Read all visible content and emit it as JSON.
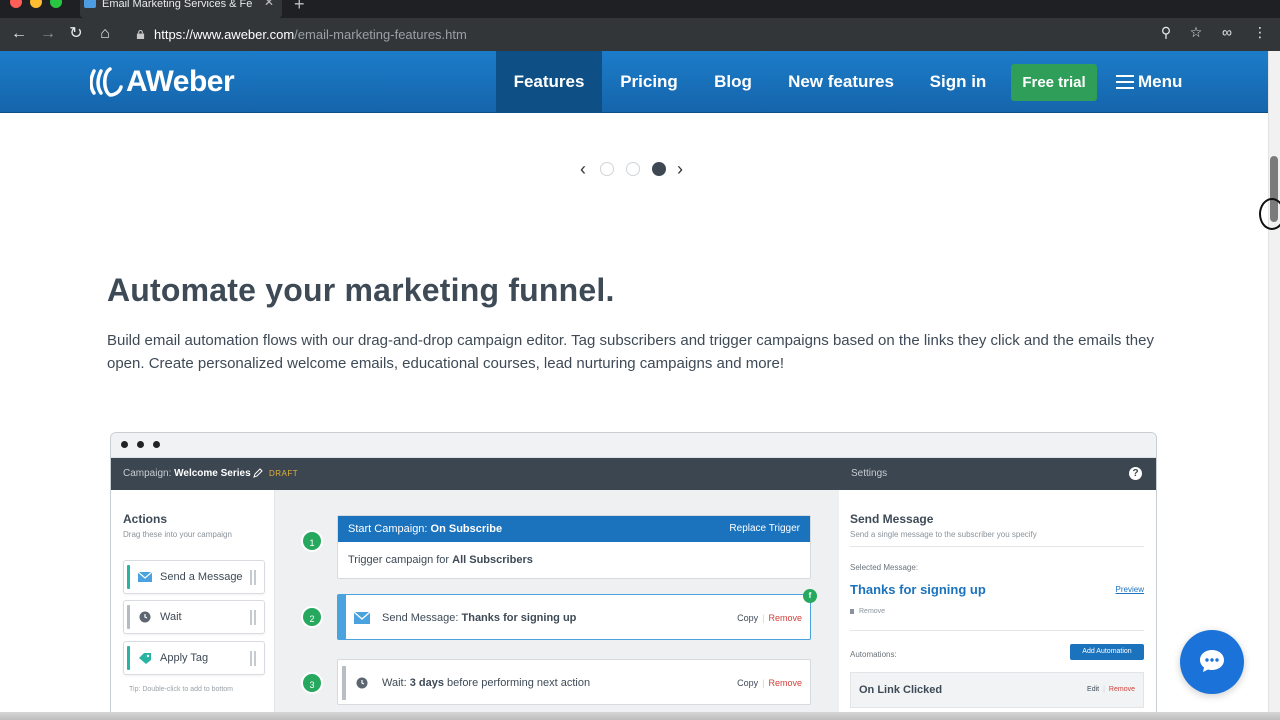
{
  "browser": {
    "tab_title": "Email Marketing Services & Fe",
    "url_host": "https://www.aweber.com",
    "url_path": "/email-marketing-features.htm"
  },
  "header": {
    "brand": "AWeber",
    "nav": [
      {
        "label": "Features",
        "active": true
      },
      {
        "label": "Pricing"
      },
      {
        "label": "Blog"
      },
      {
        "label": "New features"
      },
      {
        "label": "Sign in"
      }
    ],
    "cta": "Free trial",
    "menu": "Menu"
  },
  "carousel": {
    "prev": "‹",
    "next": "›",
    "active_index": 2,
    "count": 3
  },
  "section": {
    "title": "Automate your marketing funnel.",
    "body": "Build email automation flows with our drag-and-drop campaign editor. Tag subscribers and trigger campaigns based on the links they click and the emails they open. Create personalized welcome emails, educational courses, lead nurturing campaigns and more!"
  },
  "mockup": {
    "campaign_prefix": "Campaign: ",
    "campaign_name": "Welcome Series",
    "draft": "DRAFT",
    "settings": "Settings",
    "help": "?",
    "actions_title": "Actions",
    "actions_sub": "Drag these into your campaign",
    "actions": [
      "Send a Message",
      "Wait",
      "Apply Tag"
    ],
    "actions_tip": "Tip: Double-click to add to bottom",
    "steps": {
      "s1": "1",
      "s2": "2",
      "s3": "3",
      "start_prefix": "Start Campaign: ",
      "start_value": "On Subscribe",
      "replace": "Replace Trigger",
      "trigger_prefix": "Trigger campaign for ",
      "trigger_value": "All Subscribers",
      "send_prefix": "Send Message: ",
      "send_value": "Thanks for signing up",
      "wait_prefix": "Wait: ",
      "wait_value": "3 days",
      "wait_suffix": " before performing next action",
      "copy": "Copy",
      "remove": "Remove",
      "flag": "f"
    },
    "panel": {
      "title": "Send Message",
      "sub": "Send a single message to the subscriber you specify",
      "selected_label": "Selected Message:",
      "selected_value": "Thanks for signing up",
      "preview": "Preview",
      "remove": "Remove",
      "automations_label": "Automations:",
      "add_automation": "Add Automation",
      "on_link": "On Link Clicked",
      "edit": "Edit",
      "remove2": "Remove"
    }
  },
  "colors": {
    "brand_blue": "#1c7cc9",
    "cta_green": "#2f9e58",
    "step_green": "#27a85f",
    "remove_red": "#d0413b"
  }
}
